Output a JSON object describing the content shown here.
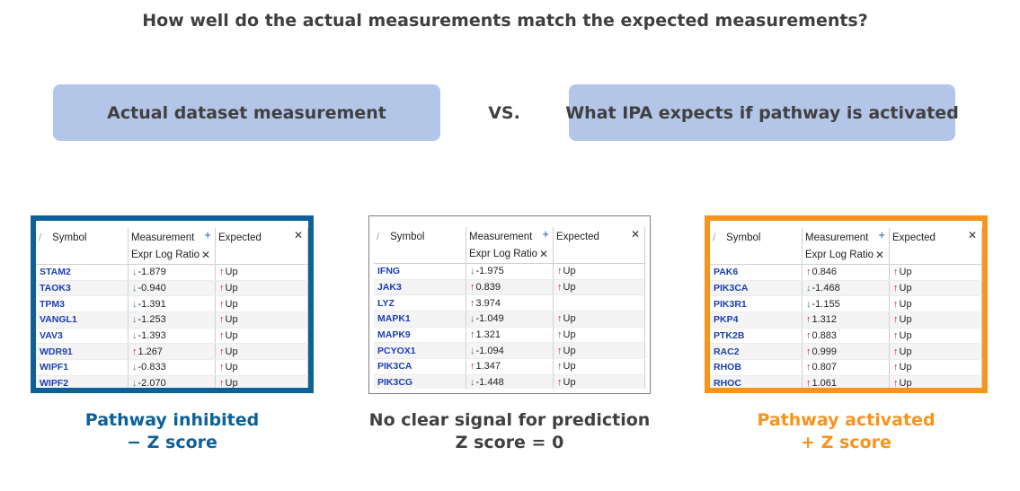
{
  "question": "How well do the actual measurements match the expected measurements?",
  "left_box": "Actual dataset measurement",
  "vs": "VS.",
  "right_box": "What IPA expects if pathway is activated",
  "columns": {
    "symbol": "Symbol",
    "measurement": "Measurement",
    "measurement_sub": "Expr Log Ratio",
    "expected": "Expected",
    "sort_mark": "/",
    "plus": "+",
    "close": "✕"
  },
  "panels": [
    {
      "caption_line1": "Pathway inhibited",
      "caption_line2": "− Z score",
      "border_color": "#0e6098",
      "rows": [
        {
          "symbol": "STAM2",
          "dir": "down",
          "value": "-1.879",
          "expected": "Up"
        },
        {
          "symbol": "TAOK3",
          "dir": "down",
          "value": "-0.940",
          "expected": "Up"
        },
        {
          "symbol": "TPM3",
          "dir": "down",
          "value": "-1.391",
          "expected": "Up"
        },
        {
          "symbol": "VANGL1",
          "dir": "down",
          "value": "-1.253",
          "expected": "Up"
        },
        {
          "symbol": "VAV3",
          "dir": "down",
          "value": "-1.393",
          "expected": "Up"
        },
        {
          "symbol": "WDR91",
          "dir": "up",
          "value": "1.267",
          "expected": "Up"
        },
        {
          "symbol": "WIPF1",
          "dir": "down",
          "value": "-0.833",
          "expected": "Up"
        },
        {
          "symbol": "WIPF2",
          "dir": "down",
          "value": "-2.070",
          "expected": "Up"
        }
      ]
    },
    {
      "caption_line1": "No clear signal for prediction",
      "caption_line2": "Z score = 0",
      "border_color": "#808080",
      "rows": [
        {
          "symbol": "IFNG",
          "dir": "down",
          "value": "-1.975",
          "expected": "Up"
        },
        {
          "symbol": "JAK3",
          "dir": "up",
          "value": "0.839",
          "expected": "Up"
        },
        {
          "symbol": "LYZ",
          "dir": "up",
          "value": "3.974",
          "expected": ""
        },
        {
          "symbol": "MAPK1",
          "dir": "down",
          "value": "-1.049",
          "expected": "Up"
        },
        {
          "symbol": "MAPK9",
          "dir": "up",
          "value": "1.321",
          "expected": "Up"
        },
        {
          "symbol": "PCYOX1",
          "dir": "down",
          "value": "-1.094",
          "expected": "Up"
        },
        {
          "symbol": "PIK3CA",
          "dir": "up",
          "value": "1.347",
          "expected": "Up"
        },
        {
          "symbol": "PIK3CG",
          "dir": "down",
          "value": "-1.448",
          "expected": "Up"
        }
      ]
    },
    {
      "caption_line1": "Pathway activated",
      "caption_line2": "+ Z score",
      "border_color": "#f7941d",
      "rows": [
        {
          "symbol": "PAK6",
          "dir": "up",
          "value": "0.846",
          "expected": "Up"
        },
        {
          "symbol": "PIK3CA",
          "dir": "down",
          "value": "-1.468",
          "expected": "Up"
        },
        {
          "symbol": "PIK3R1",
          "dir": "down",
          "value": "-1.155",
          "expected": "Up"
        },
        {
          "symbol": "PKP4",
          "dir": "up",
          "value": "1.312",
          "expected": "Up"
        },
        {
          "symbol": "PTK2B",
          "dir": "up",
          "value": "0.883",
          "expected": "Up"
        },
        {
          "symbol": "RAC2",
          "dir": "up",
          "value": "0.999",
          "expected": "Up"
        },
        {
          "symbol": "RHOB",
          "dir": "up",
          "value": "0.807",
          "expected": "Up"
        },
        {
          "symbol": "RHOC",
          "dir": "up",
          "value": "1.061",
          "expected": "Up"
        }
      ]
    }
  ]
}
